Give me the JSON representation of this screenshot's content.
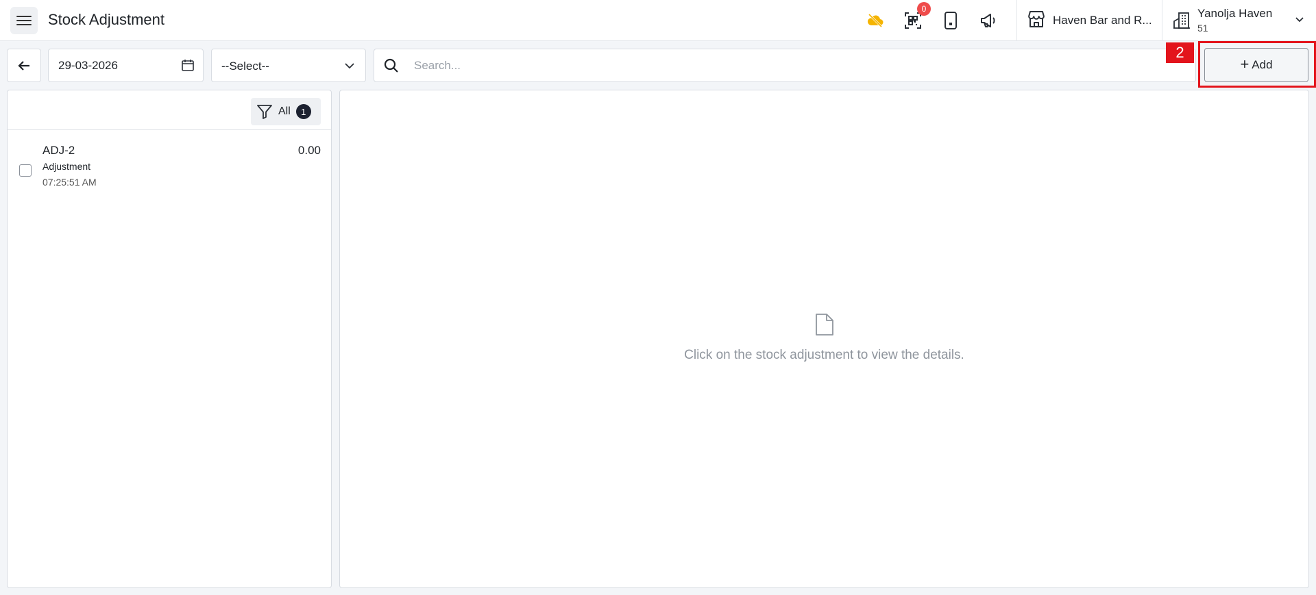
{
  "header": {
    "title": "Stock Adjustment",
    "notification_count": "0",
    "store_name": "Haven Bar and R...",
    "user_name": "Yanolja Haven",
    "user_sub": "51"
  },
  "toolbar": {
    "date": "29-03-2026",
    "select_value": "--Select--",
    "search_placeholder": "Search...",
    "add_label": "Add",
    "step_label": "2"
  },
  "filter": {
    "label": "All",
    "count": "1"
  },
  "adjustments": [
    {
      "id": "ADJ-2",
      "type": "Adjustment",
      "time": "07:25:51 AM",
      "amount": "0.00"
    }
  ],
  "details": {
    "empty_message": "Click on the stock adjustment to view the details."
  },
  "colors": {
    "accent_highlight": "#e3141c",
    "badge": "#ef4b4b",
    "cloud_icon": "#f5b400"
  }
}
